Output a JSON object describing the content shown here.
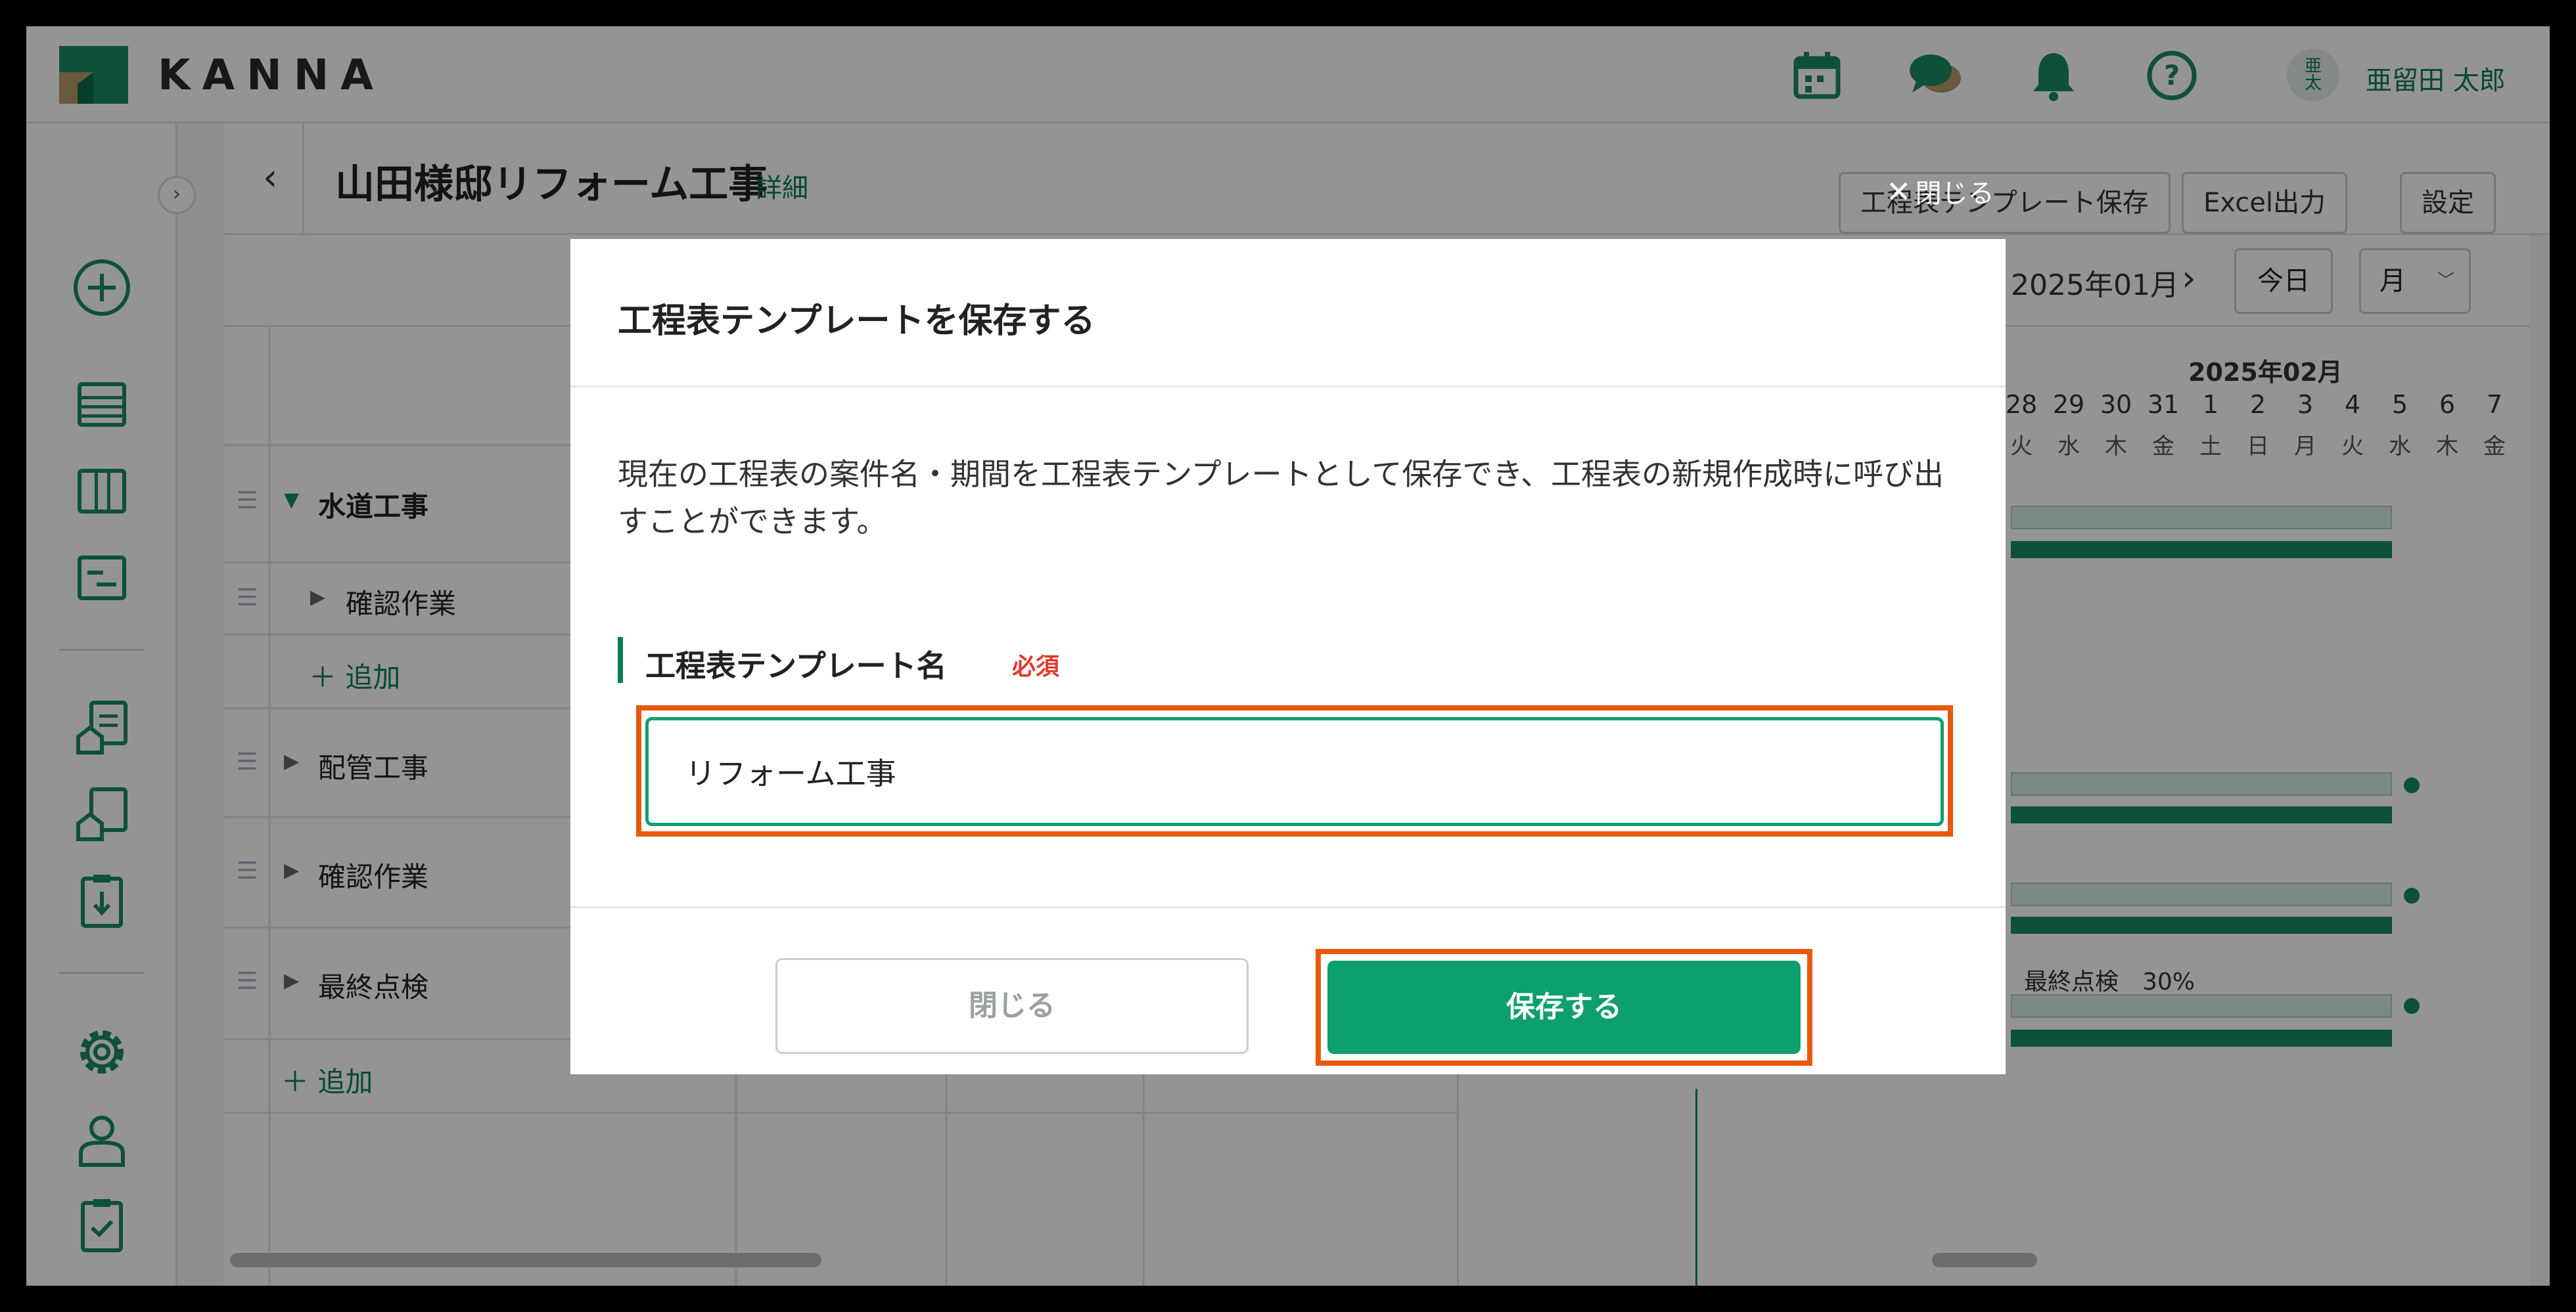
{
  "app": {
    "name": "KANNA"
  },
  "user": {
    "avatar_text": "亜\n太",
    "name": "亜留田 太郎"
  },
  "project": {
    "title": "山田様邸リフォーム工事",
    "detail_link": "詳細",
    "buttons": {
      "save_template": "工程表テンプレート保存",
      "excel_export": "Excel出力",
      "settings": "設定"
    }
  },
  "toolbar": {
    "current_month": "2025年01月",
    "today": "今日",
    "scale": "月"
  },
  "timeline": {
    "month_label": "2025年02月",
    "days": [
      "28",
      "29",
      "30",
      "31",
      "1",
      "2",
      "3",
      "4",
      "5",
      "6",
      "7"
    ],
    "weekdays": [
      "火",
      "水",
      "木",
      "金",
      "土",
      "日",
      "月",
      "火",
      "水",
      "木",
      "金"
    ],
    "progress_label": "最終点検　30%"
  },
  "tasks": [
    {
      "name": "水道工事",
      "level": 0,
      "expanded": true
    },
    {
      "name": "確認作業",
      "level": 1,
      "expanded": false
    },
    {
      "name": "配管工事",
      "level": 0,
      "expanded": false
    },
    {
      "name": "確認作業",
      "level": 0,
      "expanded": false
    },
    {
      "name": "最終点検",
      "level": 0,
      "expanded": false
    }
  ],
  "add_label": "追加",
  "overlay": {
    "close_label": "閉じる"
  },
  "modal": {
    "title": "工程表テンプレートを保存する",
    "description": "現在の工程表の案件名・期間を工程表テンプレートとして保存でき、工程表の新規作成時に呼び出すことができます。",
    "field_label": "工程表テンプレート名",
    "required": "必須",
    "name_value": "リフォーム工事",
    "close_button": "閉じる",
    "save_button": "保存する"
  },
  "colors": {
    "brand": "#0e9f6e",
    "brand_dark": "#0e7a55",
    "highlight": "#e8590c",
    "required": "#e0382b"
  },
  "icons": [
    "calendar-icon",
    "chat-icon",
    "bell-icon",
    "help-icon",
    "plus-circle-icon",
    "list-icon",
    "board-icon",
    "gantt-icon",
    "report-icon",
    "document-icon",
    "download-clipboard-icon",
    "gear-icon",
    "person-icon",
    "checklist-icon"
  ]
}
